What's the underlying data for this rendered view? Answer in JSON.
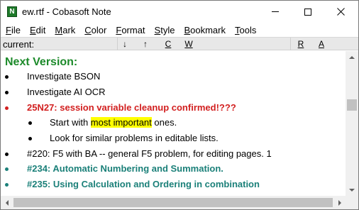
{
  "window": {
    "title": "ew.rtf - Cobasoft Note",
    "app_icon_letter": "N"
  },
  "menu": [
    {
      "label": "File"
    },
    {
      "label": "Edit"
    },
    {
      "label": "Mark"
    },
    {
      "label": "Color"
    },
    {
      "label": "Format"
    },
    {
      "label": "Style"
    },
    {
      "label": "Bookmark"
    },
    {
      "label": "Tools"
    }
  ],
  "toolbar": {
    "current_label": "current:",
    "down": "↓",
    "up": "↑",
    "c": "C",
    "w": "W",
    "r": "R",
    "a": "A"
  },
  "content": {
    "heading": "Next Version:",
    "items": [
      {
        "text": "Investigate BSON",
        "style": "normal",
        "level": 1
      },
      {
        "text": "Investigate AI OCR",
        "style": "normal",
        "level": 1
      },
      {
        "text": "25N27: session variable cleanup confirmed!???",
        "style": "red",
        "level": 1
      },
      {
        "text_before": "Start with ",
        "highlight": "most important",
        "text_after": " ones.",
        "style": "normal",
        "level": 2
      },
      {
        "text": "Look for similar problems in editable lists.",
        "style": "normal",
        "level": 2
      },
      {
        "text": "#220: F5 with BA -- general F5 problem, for editing pages. 1",
        "style": "normal",
        "level": 1
      },
      {
        "text": "#234: Automatic Numbering and Summation.",
        "style": "teal",
        "level": 1
      },
      {
        "text": "#235: Using Calculation and Ordering in combination",
        "style": "teal",
        "level": 1
      }
    ]
  },
  "colors": {
    "heading": "#1c8a2a",
    "red_item": "#d21f1f",
    "teal_item": "#1b8079",
    "highlight": "#ffff00"
  }
}
